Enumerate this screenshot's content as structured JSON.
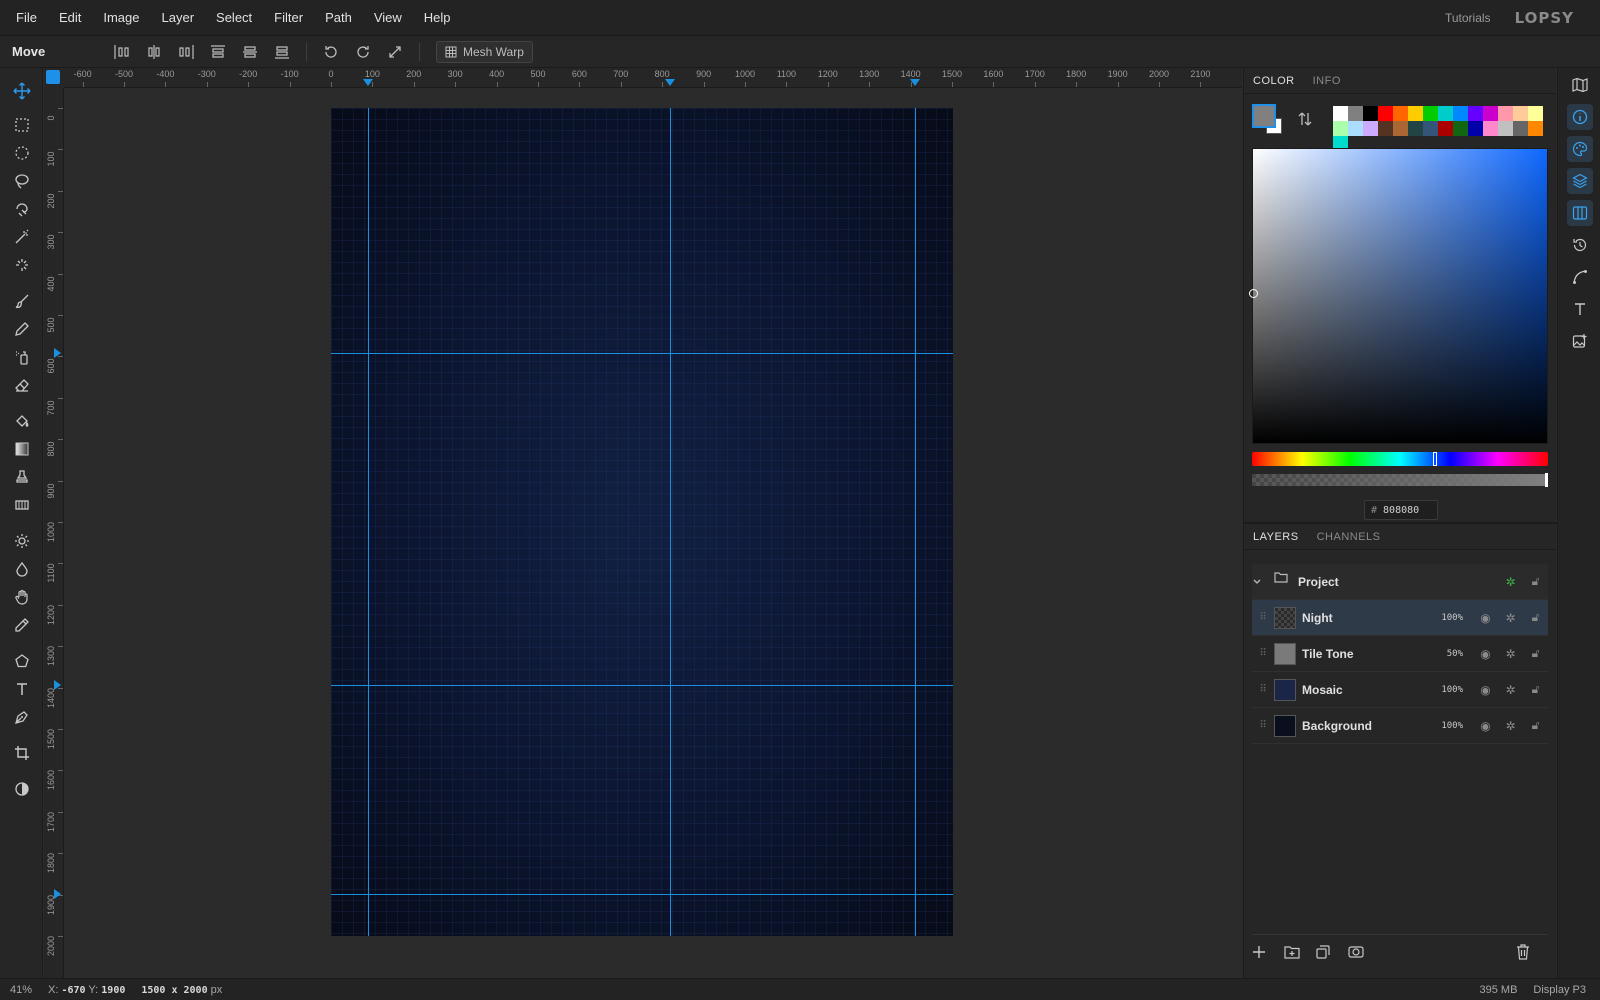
{
  "menubar": {
    "items": [
      "File",
      "Edit",
      "Image",
      "Layer",
      "Select",
      "Filter",
      "Path",
      "View",
      "Help"
    ],
    "tutorials": "Tutorials",
    "logo": "LOPSY"
  },
  "options": {
    "tool_name": "Move",
    "mesh_warp": "Mesh Warp"
  },
  "rulers": {
    "h_labels": [
      "-600",
      "-500",
      "-400",
      "-300",
      "-200",
      "-100",
      "0",
      "100",
      "200",
      "300",
      "400",
      "500",
      "600",
      "700",
      "800",
      "900",
      "1000",
      "1100",
      "1200",
      "1300",
      "1400",
      "1500",
      "1600",
      "1700",
      "1800",
      "1900",
      "2000",
      "2100"
    ],
    "v_labels": [
      "0",
      "100",
      "200",
      "300",
      "400",
      "500",
      "600",
      "700",
      "800",
      "900",
      "1000",
      "1100",
      "1200",
      "1300",
      "1400",
      "1500",
      "1600",
      "1700",
      "1800",
      "1900",
      "2000"
    ]
  },
  "color_panel": {
    "tabs": [
      "COLOR",
      "INFO"
    ],
    "hex_hash": "#",
    "hex_value": "808080",
    "fg_color": "#808080",
    "bg_color": "#ffffff",
    "swatches": [
      "#ffffff",
      "#808080",
      "#000000",
      "#ff0000",
      "#ff6600",
      "#ffcc00",
      "#00cc00",
      "#00cccc",
      "#0088ff",
      "#6600ff",
      "#cc00cc",
      "#ff99aa",
      "#ffcc99",
      "#ffff99",
      "#aaffaa",
      "#aaddff",
      "#ccaaff",
      "#553322",
      "#aa6633",
      "#224444",
      "#335577",
      "#aa0000",
      "#116611",
      "#0000aa",
      "#ff88cc",
      "#c0c0c0",
      "#666666",
      "#ff8800",
      "#00ddcc"
    ]
  },
  "layers_panel": {
    "tabs": [
      "LAYERS",
      "CHANNELS"
    ],
    "group": "Project",
    "layers": [
      {
        "name": "Night",
        "opacity": "100%"
      },
      {
        "name": "Tile Tone",
        "opacity": "50%"
      },
      {
        "name": "Mosaic",
        "opacity": "100%"
      },
      {
        "name": "Background",
        "opacity": "100%"
      }
    ]
  },
  "status": {
    "zoom": "41%",
    "x_label": "X:",
    "x_value": "-670",
    "y_label": "Y:",
    "y_value": "1900",
    "dims": "1500 x 2000",
    "dims_unit": "px",
    "memory": "395 MB",
    "display": "Display P3"
  },
  "accent": "#1e90e8"
}
